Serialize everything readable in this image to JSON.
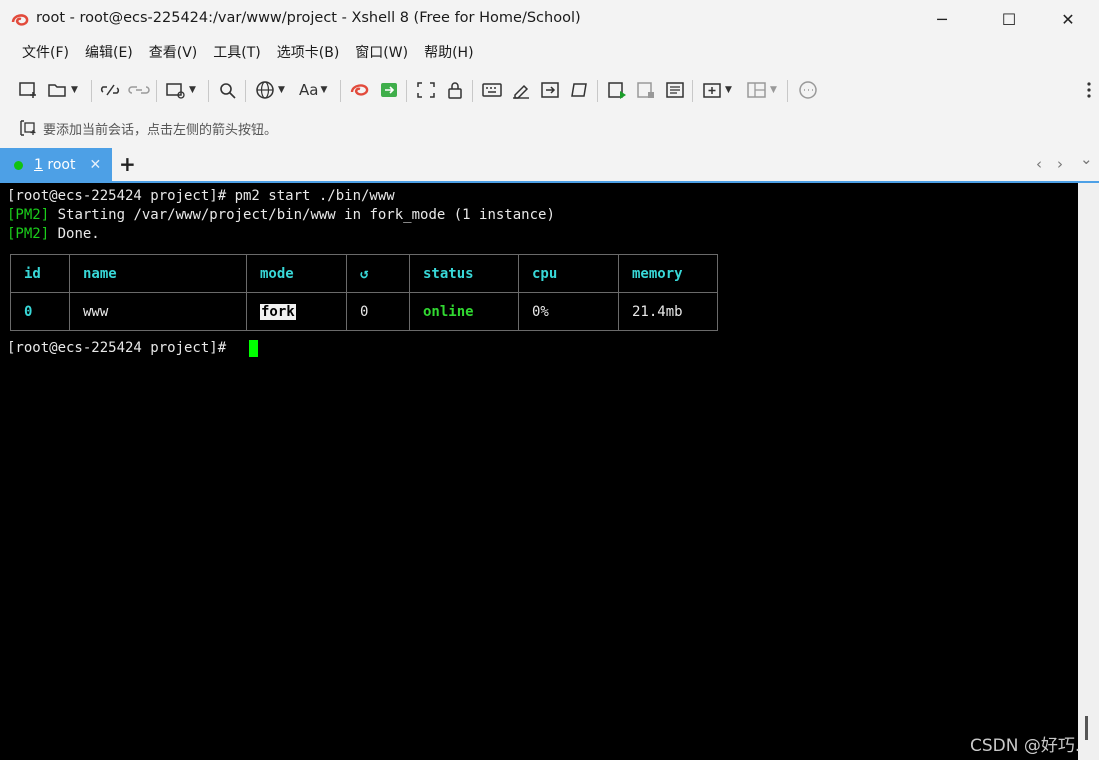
{
  "window": {
    "title": "root - root@ecs-225424:/var/www/project - Xshell 8 (Free for Home/School)",
    "minimize": "─",
    "maximize": "☐",
    "close": "✕"
  },
  "menu": [
    "文件(F)",
    "编辑(E)",
    "查看(V)",
    "工具(T)",
    "选项卡(B)",
    "窗口(W)",
    "帮助(H)"
  ],
  "hint": "要添加当前会话，点击左侧的箭头按钮。",
  "tabs": {
    "active": {
      "number": "1",
      "name": " root",
      "close": "✕"
    },
    "add": "+",
    "prev": "‹",
    "next": "›",
    "more": "⌄"
  },
  "terminal": {
    "line1": "[root@ecs-225424 project]# pm2 start ./bin/www",
    "line2_tag": "[PM2]",
    "line2_text": " Starting /var/www/project/bin/www in fork_mode (1 instance)",
    "line3_tag": "[PM2]",
    "line3_text": " Done.",
    "table": {
      "headers": [
        "id",
        "name",
        "mode",
        "↺",
        "status",
        "cpu",
        "memory"
      ],
      "row": {
        "id": "0",
        "name": "www",
        "mode": "fork",
        "restarts": "0",
        "status": "online",
        "cpu": "0%",
        "memory": "21.4mb"
      }
    },
    "prompt": "[root@ecs-225424 project]# "
  },
  "colors": {
    "accent": "#4da0e6",
    "terminal_bg": "#000000",
    "cursor": "#00ff00",
    "pm2_green": "#1bcc1b",
    "header_cyan": "#38d7d7"
  },
  "watermark": "CSDN @好巧."
}
